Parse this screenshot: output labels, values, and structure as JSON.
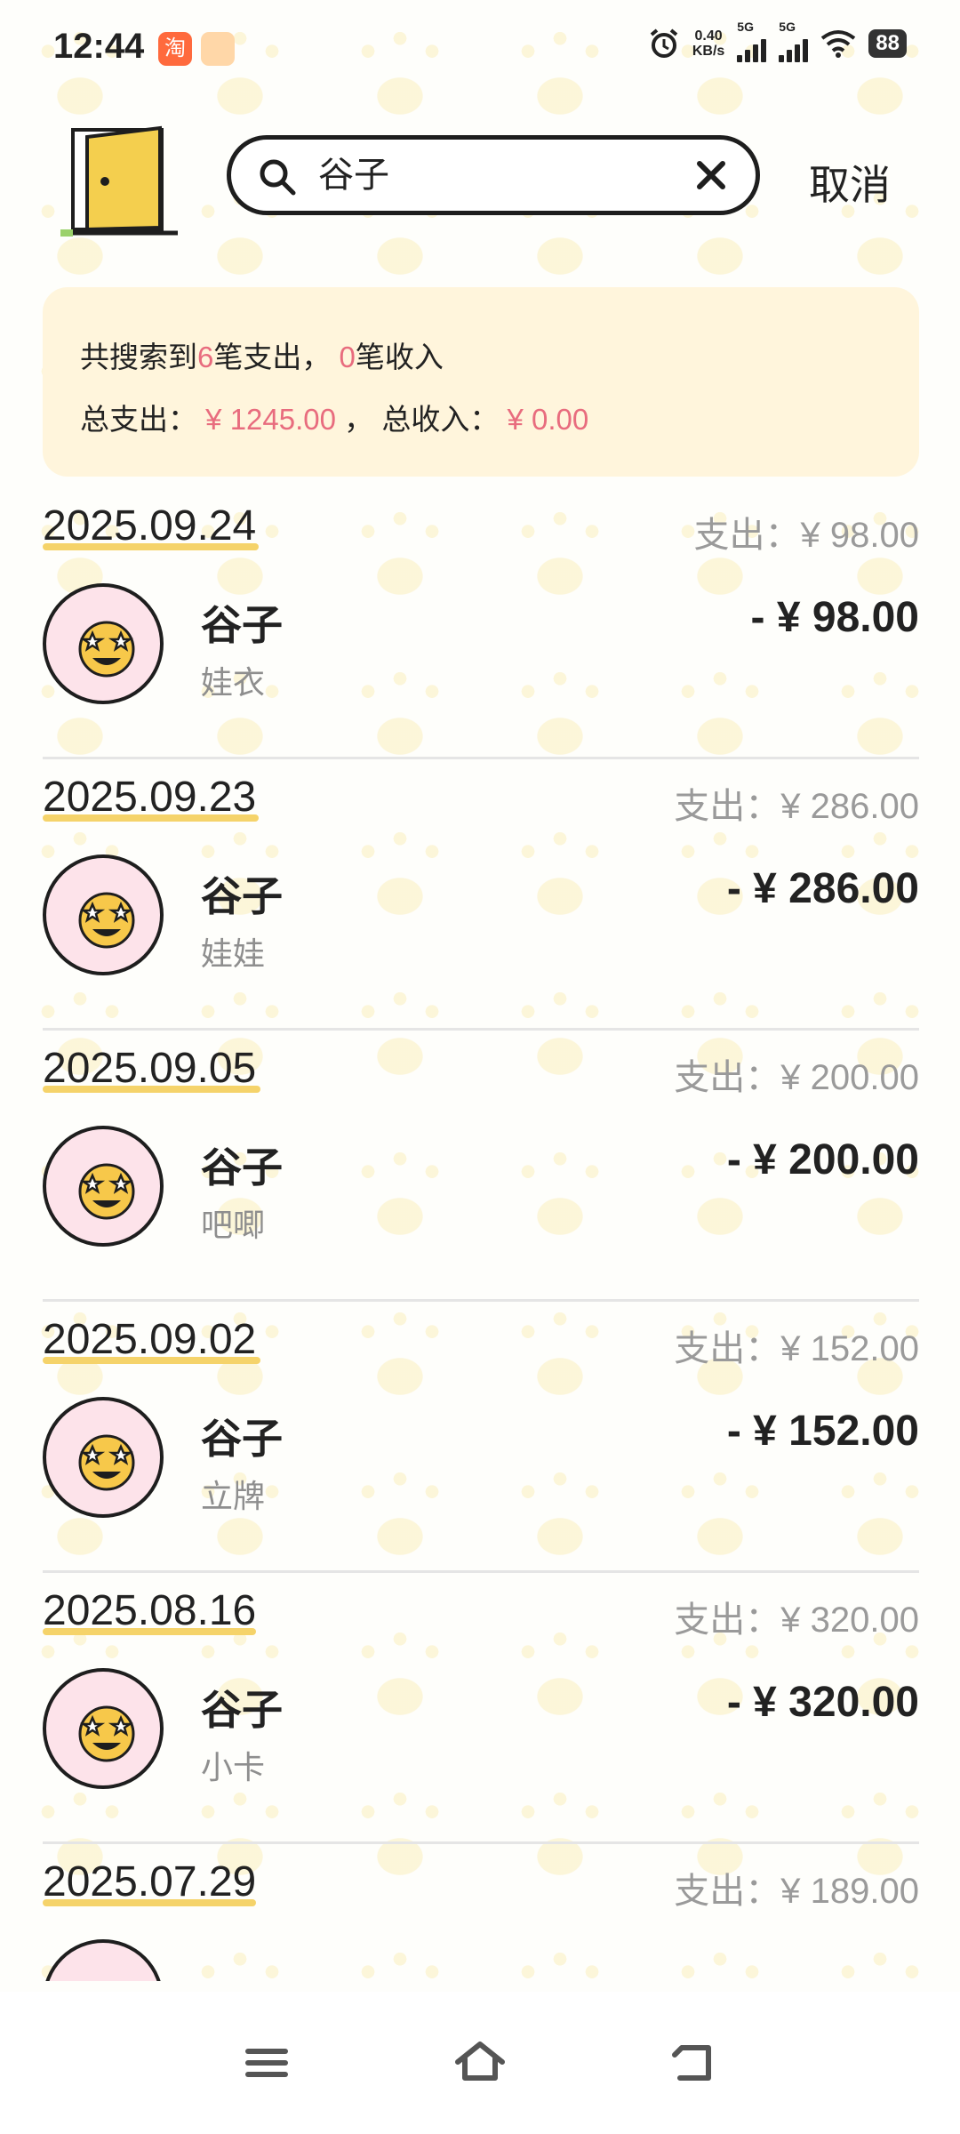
{
  "status_bar": {
    "time": "12:44",
    "net_speed_value": "0.40",
    "net_speed_unit": "KB/s",
    "signal1_label": "5G",
    "signal2_label": "5G",
    "battery": "88"
  },
  "search": {
    "query": "谷子",
    "cancel_label": "取消"
  },
  "summary": {
    "prefix": "共搜索到",
    "expense_count": "6",
    "expense_suffix": "笔支出，",
    "income_count": "0",
    "income_suffix": "笔收入",
    "total_expense_label": "总支出：",
    "total_expense": "¥ 1245.00",
    "sep": "，",
    "total_income_label": "总收入：",
    "total_income": "¥ 0.00"
  },
  "groups": [
    {
      "date": "2025.09.24",
      "day_total": "支出：¥ 98.00",
      "title": "谷子",
      "note": "娃衣",
      "amount": "- ¥ 98.00"
    },
    {
      "date": "2025.09.23",
      "day_total": "支出：¥ 286.00",
      "title": "谷子",
      "note": "娃娃",
      "amount": "- ¥ 286.00"
    },
    {
      "date": "2025.09.05",
      "day_total": "支出：¥ 200.00",
      "title": "谷子",
      "note": "吧唧",
      "amount": "- ¥ 200.00"
    },
    {
      "date": "2025.09.02",
      "day_total": "支出：¥ 152.00",
      "title": "谷子",
      "note": "立牌",
      "amount": "- ¥ 152.00"
    },
    {
      "date": "2025.08.16",
      "day_total": "支出：¥ 320.00",
      "title": "谷子",
      "note": "小卡",
      "amount": "- ¥ 320.00"
    },
    {
      "date": "2025.07.29",
      "day_total": "支出：¥ 189.00"
    }
  ],
  "colors": {
    "accent_pink": "#e86c7e",
    "underline_yellow": "#f5d36a",
    "card_bg": "#fff5dc",
    "avatar_bg": "#fde3ea"
  },
  "icons": [
    "door-icon",
    "search-icon",
    "clear-icon",
    "star-eyes-emoji-icon",
    "menu-icon",
    "home-icon",
    "back-icon"
  ]
}
